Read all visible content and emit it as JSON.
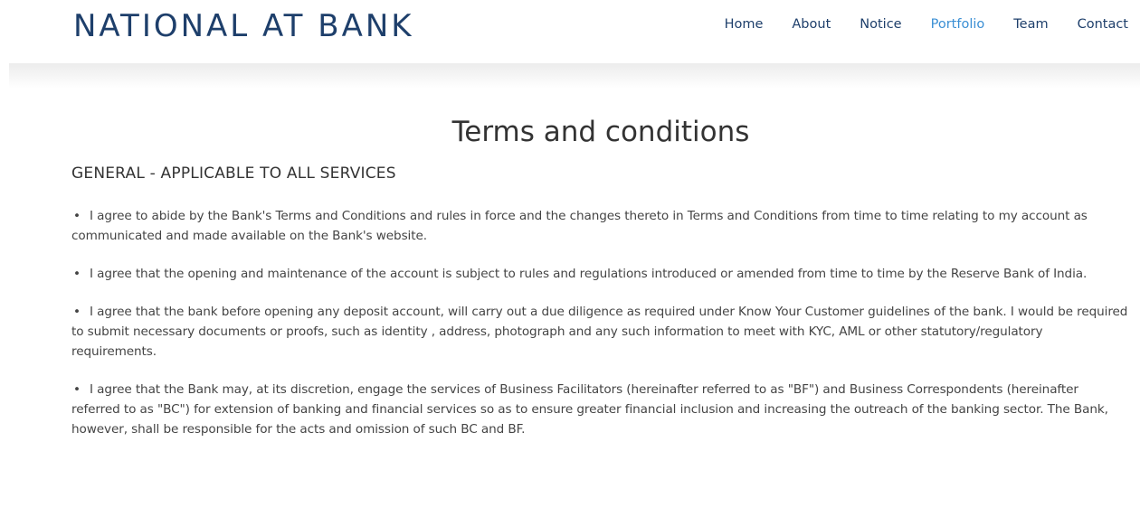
{
  "header": {
    "logo_text": "NATIONAL AT BANK",
    "nav": [
      {
        "label": "Home",
        "active": false
      },
      {
        "label": "About",
        "active": false
      },
      {
        "label": "Notice",
        "active": false
      },
      {
        "label": "Portfolio",
        "active": true
      },
      {
        "label": "Team",
        "active": false
      },
      {
        "label": "Contact",
        "active": false
      }
    ]
  },
  "main": {
    "title": "Terms and conditions",
    "section_heading": "GENERAL - APPLICABLE TO ALL SERVICES",
    "bullet_glyph": "•",
    "terms": [
      "I agree to abide by the Bank's Terms and Conditions and rules in force and the changes thereto in Terms and Conditions from time to time relating to my account as communicated and made available on the Bank's website.",
      "I agree that the opening and maintenance of the account is subject to rules and regulations introduced or amended from time to time by the Reserve Bank of India.",
      "I agree that the bank before opening any deposit account, will carry out a due diligence as required under Know Your Customer guidelines of the bank. I would be required to submit necessary documents or proofs, such as identity , address, photograph and any such information to meet with KYC, AML or other statutory/regulatory requirements.",
      "I agree that the Bank may, at its discretion, engage the services of Business Facilitators (hereinafter referred to as \"BF\") and Business Correspondents (hereinafter referred to as \"BC\") for extension of banking and financial services so as to ensure greater financial inclusion and increasing the outreach of the banking sector. The Bank, however, shall be responsible for the acts and omission of such BC and BF."
    ]
  },
  "colors": {
    "brand": "#1e3f6b",
    "nav_active": "#3b8fd4",
    "body_text": "#444444"
  }
}
